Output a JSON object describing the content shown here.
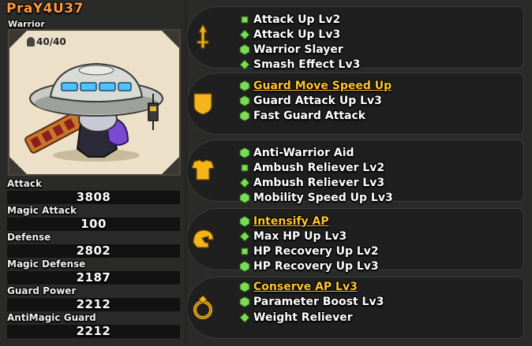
{
  "character": {
    "name": "PraY4U37",
    "job": "Warrior",
    "level": "40/40"
  },
  "stats": [
    {
      "label": "Attack",
      "value": "3808"
    },
    {
      "label": "Magic Attack",
      "value": "100"
    },
    {
      "label": "Defense",
      "value": "2802"
    },
    {
      "label": "Magic Defense",
      "value": "2187"
    },
    {
      "label": "Guard Power",
      "value": "2212"
    },
    {
      "label": "AntiMagic Guard",
      "value": "2212"
    }
  ],
  "skill_groups": [
    {
      "icon": "sword-category-icon",
      "skills": [
        {
          "name": "Attack Up Lv2",
          "icon": "square-gem-icon",
          "highlight": false
        },
        {
          "name": "Attack Up Lv3",
          "icon": "diamond-gem-icon",
          "highlight": false
        },
        {
          "name": "Warrior Slayer",
          "icon": "hexagon-gem-icon",
          "highlight": false
        },
        {
          "name": "Smash Effect Lv3",
          "icon": "diamond-gem-icon",
          "highlight": false
        }
      ]
    },
    {
      "icon": "shield-category-icon",
      "skills": [
        {
          "name": "Guard Move Speed Up",
          "icon": "hexagon-gem-icon",
          "highlight": true
        },
        {
          "name": "Guard Attack Up Lv3",
          "icon": "hexagon-gem-icon",
          "highlight": false
        },
        {
          "name": "Fast Guard Attack",
          "icon": "hexagon-gem-icon",
          "highlight": false
        }
      ]
    },
    {
      "icon": "armor-category-icon",
      "skills": [
        {
          "name": "Anti-Warrior Aid",
          "icon": "hexagon-gem-icon",
          "highlight": false
        },
        {
          "name": "Ambush Reliever Lv2",
          "icon": "square-gem-icon",
          "highlight": false
        },
        {
          "name": "Ambush Reliever Lv3",
          "icon": "diamond-gem-icon",
          "highlight": false
        },
        {
          "name": "Mobility Speed Up Lv3",
          "icon": "hexagon-gem-icon",
          "highlight": false
        }
      ]
    },
    {
      "icon": "helmet-category-icon",
      "skills": [
        {
          "name": "Intensify AP",
          "icon": "hexagon-gem-icon",
          "highlight": true
        },
        {
          "name": "Max HP Up Lv3",
          "icon": "diamond-gem-icon",
          "highlight": false
        },
        {
          "name": "HP Recovery Up Lv2",
          "icon": "square-gem-icon",
          "highlight": false
        },
        {
          "name": "HP Recovery Up Lv3",
          "icon": "hexagon-gem-icon",
          "highlight": false
        }
      ]
    },
    {
      "icon": "ring-category-icon",
      "skills": [
        {
          "name": "Conserve AP Lv3",
          "icon": "hexagon-gem-icon",
          "highlight": true
        },
        {
          "name": "Parameter Boost Lv3",
          "icon": "hexagon-gem-icon",
          "highlight": false
        },
        {
          "name": "Weight Reliever",
          "icon": "diamond-gem-icon",
          "highlight": false
        }
      ]
    }
  ],
  "colors": {
    "highlight_text": "#ffc62b",
    "name_text": "#ff9a3c",
    "gem_green": "#7ed957",
    "category_gold": "#f4b41a"
  }
}
